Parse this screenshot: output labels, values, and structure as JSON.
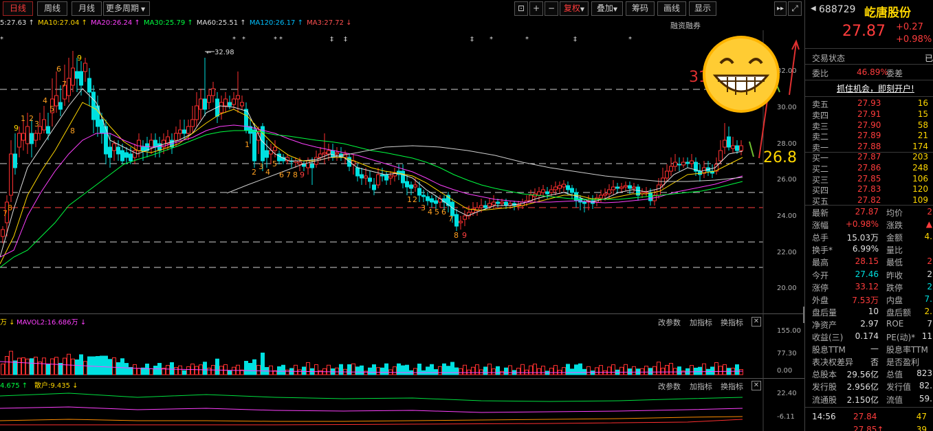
{
  "toolbar": {
    "periods": [
      "日线",
      "周线",
      "月线",
      "更多周期"
    ],
    "active_period": "日线",
    "right_tools": [
      "复权",
      "叠加",
      "筹码",
      "画线",
      "显示"
    ],
    "fq": "复权"
  },
  "ma_legend": [
    {
      "text": "5:27.63 ↑",
      "color": "#e0e0e0"
    },
    {
      "text": "MA10:27.04 ↑",
      "color": "#ffd700"
    },
    {
      "text": "MA20:26.24 ↑",
      "color": "#ff40ff"
    },
    {
      "text": "MA30:25.79 ↑",
      "color": "#00ff40"
    },
    {
      "text": "MA60:25.51 ↑",
      "color": "#e0e0e0"
    },
    {
      "text": "MA120:26.17 ↑",
      "color": "#00c0ff"
    },
    {
      "text": "MA3:27.72 ↓",
      "color": "#ff5050"
    }
  ],
  "rzrq": "融资融券",
  "price_axis": [
    "32.00",
    "30.00",
    "28.00",
    "26.00",
    "24.00",
    "22.00",
    "20.00"
  ],
  "annotations": {
    "high_label": "32.98",
    "red_num": "31",
    "yel_num": "26.8"
  },
  "volume_panel": {
    "legend_a": "万 ↓",
    "legend_b": "MAVOL2:16.686万 ↓",
    "axis": [
      "155.00",
      "77.30",
      "0.00"
    ],
    "buttons": [
      "改参数",
      "加指标",
      "换指标"
    ]
  },
  "ind_panel": {
    "legend_a": "4.675 ↑",
    "legend_b": "散户:9.435 ↓",
    "axis": [
      "22.40",
      "-6.11"
    ],
    "buttons": [
      "改参数",
      "加指标",
      "换指标"
    ]
  },
  "stock": {
    "code": "688729",
    "name": "屹唐股份",
    "price": "27.87",
    "change": "+0.27",
    "pct": "+0.98%"
  },
  "status": {
    "label": "交易状态",
    "value": "已"
  },
  "weibi": {
    "label": "委比",
    "value": "46.89%",
    "label2": "委差"
  },
  "promo": "抓住机会，即刻开户!",
  "asks": [
    {
      "label": "卖五",
      "price": "27.93",
      "vol": "16"
    },
    {
      "label": "卖四",
      "price": "27.91",
      "vol": "15"
    },
    {
      "label": "卖三",
      "price": "27.90",
      "vol": "58"
    },
    {
      "label": "卖二",
      "price": "27.89",
      "vol": "21"
    },
    {
      "label": "卖一",
      "price": "27.88",
      "vol": "174"
    }
  ],
  "bids": [
    {
      "label": "买一",
      "price": "27.87",
      "vol": "203"
    },
    {
      "label": "买二",
      "price": "27.86",
      "vol": "248"
    },
    {
      "label": "买三",
      "price": "27.85",
      "vol": "106"
    },
    {
      "label": "买四",
      "price": "27.83",
      "vol": "120"
    },
    {
      "label": "买五",
      "price": "27.82",
      "vol": "109"
    }
  ],
  "stats": [
    {
      "l": "最新",
      "v": "27.87",
      "vc": "red",
      "l2": "均价",
      "v2": "2",
      "v2c": "red"
    },
    {
      "l": "涨幅",
      "v": "+0.98%",
      "vc": "red",
      "l2": "涨跌",
      "v2": "▲",
      "v2c": "red"
    },
    {
      "l": "总手",
      "v": "15.03万",
      "vc": "wht",
      "l2": "金额",
      "v2": "4.",
      "v2c": "yel"
    },
    {
      "l": "换手*",
      "v": "6.99%",
      "vc": "wht",
      "l2": "量比",
      "v2": "",
      "v2c": "wht"
    },
    {
      "l": "最高",
      "v": "28.15",
      "vc": "red",
      "l2": "最低",
      "v2": "2",
      "v2c": "red"
    },
    {
      "l": "今开",
      "v": "27.46",
      "vc": "grn",
      "l2": "昨收",
      "v2": "2",
      "v2c": "wht"
    },
    {
      "l": "涨停",
      "v": "33.12",
      "vc": "red",
      "l2": "跌停",
      "v2": "2",
      "v2c": "grn"
    },
    {
      "l": "外盘",
      "v": "7.53万",
      "vc": "red",
      "l2": "内盘",
      "v2": "7.",
      "v2c": "grn"
    },
    {
      "l": "盘后量",
      "v": "10",
      "vc": "wht",
      "l2": "盘后额",
      "v2": "2.",
      "v2c": "yel"
    },
    {
      "l": "净资产",
      "v": "2.97",
      "vc": "wht",
      "l2": "ROE",
      "v2": "7",
      "v2c": "wht"
    },
    {
      "l": "收益(三)",
      "v": "0.174",
      "vc": "wht",
      "l2": "PE(动)*",
      "v2": "11",
      "v2c": "wht"
    },
    {
      "l": "股息TTM",
      "v": "—",
      "vc": "wht",
      "l2": "股息率TTM",
      "v2": "",
      "v2c": "wht"
    },
    {
      "l": "表决权差异",
      "v": "否",
      "vc": "wht",
      "l2": "是否盈利",
      "v2": "",
      "v2c": "wht"
    },
    {
      "l": "总股本",
      "v": "29.56亿",
      "vc": "wht",
      "l2": "总值",
      "v2": "823",
      "v2c": "wht"
    },
    {
      "l": "发行股",
      "v": "2.956亿",
      "vc": "wht",
      "l2": "发行值",
      "v2": "82.",
      "v2c": "wht"
    },
    {
      "l": "流通股",
      "v": "2.150亿",
      "vc": "wht",
      "l2": "流值",
      "v2": "59.",
      "v2c": "wht"
    }
  ],
  "ticks": [
    {
      "time": "14:56",
      "price": "27.84",
      "vol": "47"
    },
    {
      "time": "",
      "price": "27.85↑",
      "vol": "39"
    }
  ]
}
